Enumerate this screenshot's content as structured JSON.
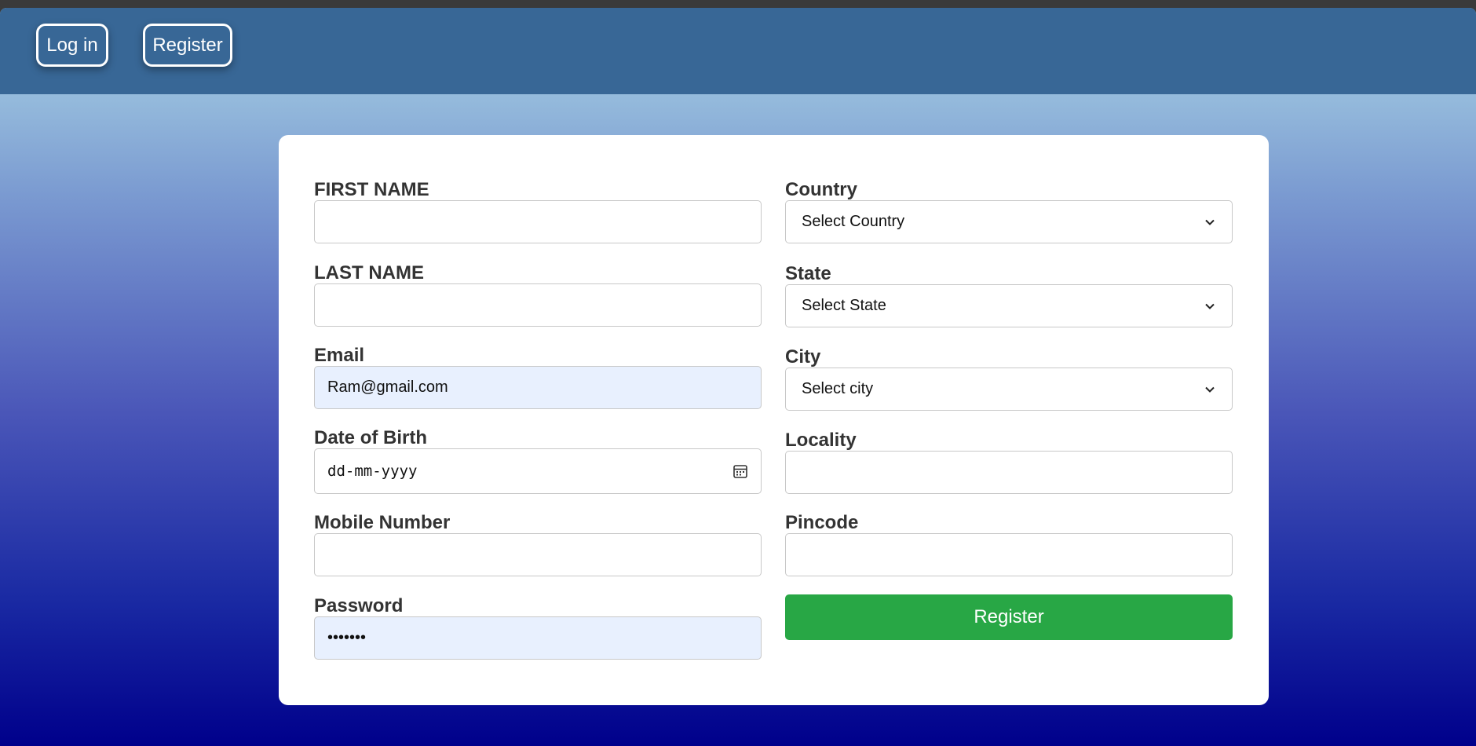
{
  "nav": {
    "login_label": "Log in",
    "register_label": "Register"
  },
  "form": {
    "left": {
      "first_name": {
        "label": "FIRST NAME",
        "value": ""
      },
      "last_name": {
        "label": "LAST NAME",
        "value": ""
      },
      "email": {
        "label": "Email",
        "value": "Ram@gmail.com"
      },
      "dob": {
        "label": "Date of Birth",
        "placeholder": "dd-mm-yyyy"
      },
      "mobile": {
        "label": "Mobile Number",
        "value": ""
      },
      "password": {
        "label": "Password",
        "value": "•••••••"
      }
    },
    "right": {
      "country": {
        "label": "Country",
        "selected": "Select Country"
      },
      "state": {
        "label": "State",
        "selected": "Select State"
      },
      "city": {
        "label": "City",
        "selected": "Select city"
      },
      "locality": {
        "label": "Locality",
        "value": ""
      },
      "pincode": {
        "label": "Pincode",
        "value": ""
      }
    },
    "submit_label": "Register"
  },
  "colors": {
    "navbar": "#386796",
    "submit": "#28a745",
    "autofill": "#e8f0fe",
    "gradient_top": "#add8e6",
    "gradient_bottom": "#00008b"
  }
}
